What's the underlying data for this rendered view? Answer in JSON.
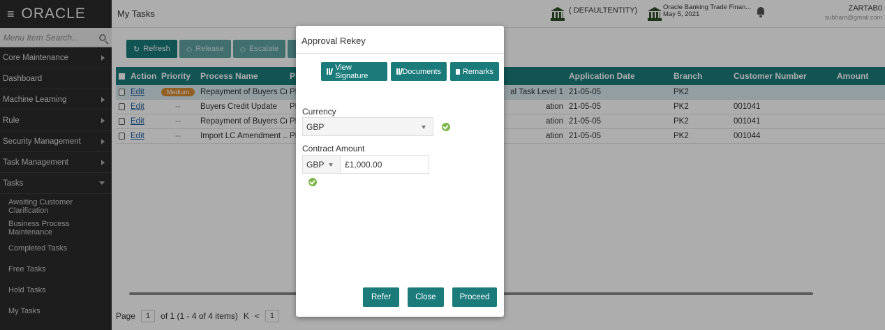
{
  "sidebar": {
    "logo": "ORACLE",
    "search_placeholder": "Menu Item Search...",
    "items": [
      {
        "label": "Core Maintenance"
      },
      {
        "label": "Dashboard"
      },
      {
        "label": "Machine Learning"
      },
      {
        "label": "Rule"
      },
      {
        "label": "Security Management"
      },
      {
        "label": "Task Management"
      },
      {
        "label": "Tasks"
      }
    ],
    "sub_items": [
      {
        "label": "Awaiting Customer Clarification"
      },
      {
        "label": "Business Process Maintenance"
      },
      {
        "label": "Completed Tasks"
      },
      {
        "label": "Free Tasks"
      },
      {
        "label": "Hold Tasks"
      },
      {
        "label": "My Tasks"
      }
    ]
  },
  "header": {
    "page_title": "My Tasks",
    "entity": "( DEFAULTENTITY)",
    "bank_name": "Oracle Banking Trade Finan...",
    "bank_date": "May 5, 2021",
    "user_name": "ZARTAB0",
    "user_email": "subham@gmail.com"
  },
  "toolbar": {
    "refresh": "Refresh",
    "release": "Release",
    "escalate": "Escalate",
    "delegate": "D"
  },
  "grid": {
    "columns": [
      "Action",
      "Priority",
      "Process Name",
      "Pr",
      "Application Date",
      "Branch",
      "Customer Number",
      "Amount"
    ],
    "rows": [
      {
        "action": "Edit",
        "priority": "Medium",
        "process": "Repayment of Buyers Cr...",
        "pr": "PK",
        "stage": "al Task Level 1",
        "date": "21-05-05",
        "branch": "PK2",
        "customer": ""
      },
      {
        "action": "Edit",
        "priority": "--",
        "process": "Buyers Credit Update",
        "pr": "PK",
        "stage": "ation",
        "date": "21-05-05",
        "branch": "PK2",
        "customer": "001041"
      },
      {
        "action": "Edit",
        "priority": "--",
        "process": "Repayment of Buyers Cr...",
        "pr": "PK",
        "stage": "ation",
        "date": "21-05-05",
        "branch": "PK2",
        "customer": "001041"
      },
      {
        "action": "Edit",
        "priority": "--",
        "process": "Import LC Amendment ...",
        "pr": "PK",
        "stage": "ation",
        "date": "21-05-05",
        "branch": "PK2",
        "customer": "001044"
      }
    ]
  },
  "pager": {
    "label": "Page",
    "page": "1",
    "summary": "of 1  (1 - 4 of 4 items)",
    "first": "K",
    "prev": "<",
    "current": "1"
  },
  "modal": {
    "title": "Approval Rekey",
    "view_signature": "View Signature",
    "documents": "Documents",
    "remarks": "Remarks",
    "currency_label": "Currency",
    "currency_value": "GBP",
    "contract_amount_label": "Contract Amount",
    "amount_currency": "GBP",
    "amount_value": "£1,000.00",
    "refer": "Refer",
    "close": "Close",
    "proceed": "Proceed"
  },
  "colors": {
    "accent": "#1b7b7b",
    "sidebar": "#2b2b2b",
    "ok": "#7ab648",
    "badge": "#d98e36"
  }
}
